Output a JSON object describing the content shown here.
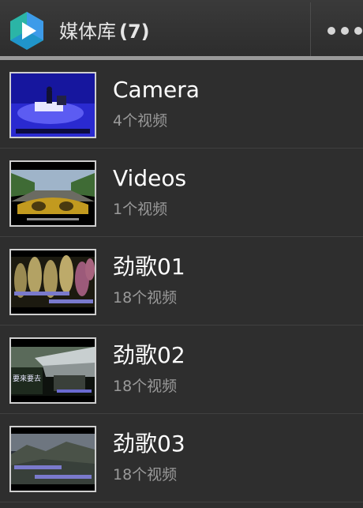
{
  "header": {
    "title": "媒体库",
    "count": "(7)"
  },
  "albums": [
    {
      "name": "Camera",
      "count": "4个视频"
    },
    {
      "name": "Videos",
      "count": "1个视频"
    },
    {
      "name": "劲歌01",
      "count": "18个视频"
    },
    {
      "name": "劲歌02",
      "count": "18个视频"
    },
    {
      "name": "劲歌03",
      "count": "18个视频"
    }
  ],
  "thumbnails": [
    {
      "caption_line1": "",
      "caption_line2": ""
    },
    {
      "caption_line1": "",
      "caption_line2": ""
    },
    {
      "caption_line1": "",
      "caption_line2": ""
    },
    {
      "caption_line1": "要來要去",
      "caption_line2": ""
    },
    {
      "caption_line1": "",
      "caption_line2": ""
    }
  ],
  "colors": {
    "header_background": "#333333",
    "list_background": "#2e2e2e",
    "primary_text": "#ffffff",
    "secondary_text": "#9a9a9a",
    "logo_teal": "#2bb5a6",
    "logo_blue": "#3d9be9"
  }
}
